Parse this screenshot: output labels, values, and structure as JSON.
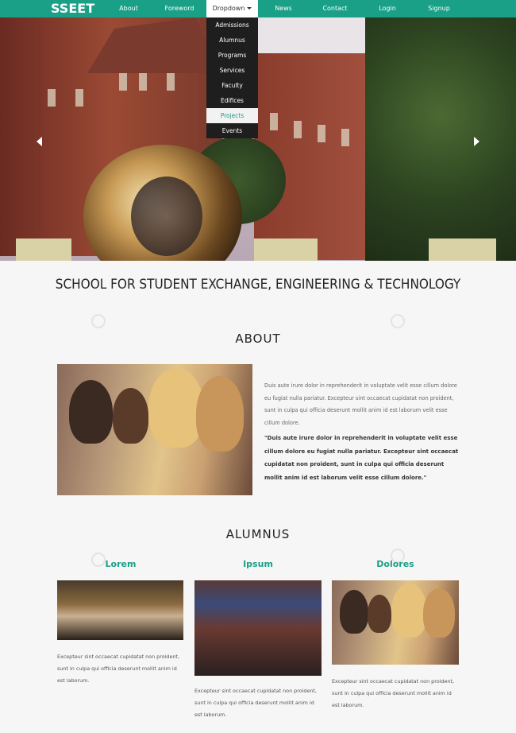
{
  "brand": "SSEET",
  "nav": {
    "items": [
      "About",
      "Foreword",
      "Dropdown",
      "News",
      "Contact",
      "Login",
      "Signup"
    ]
  },
  "dropdown": {
    "items": [
      "Admissions",
      "Alumnus",
      "Programs",
      "Services",
      "Faculty",
      "Edifices",
      "Projects",
      "Events"
    ]
  },
  "main_title": "SCHOOL FOR STUDENT EXCHANGE, ENGINEERING & TECHNOLOGY",
  "about": {
    "heading": "ABOUT",
    "paragraph": "Duis aute irure dolor in reprehenderit in voluptate velit esse cillum dolore eu fugiat nulla pariatur. Excepteur sint occaecat cupidatat non proident, sunt in culpa qui officia deserunt mollit anim id est laborum velit esse cillum dolore.",
    "quote": "\"Duis aute irure dolor in reprehenderit in voluptate velit esse cillum dolore eu fugiat nulla pariatur. Excepteur sint occaecat cupidatat non proident, sunt in culpa qui officia deserunt mollit anim id est laborum velit esse cillum dolore.\""
  },
  "alumnus": {
    "heading": "ALUMNUS",
    "columns": [
      {
        "title": "Lorem",
        "text": "Excepteur sint occaecat cupidatat non proident, sunt in culpa qui officia deserunt mollit anim id est laborum."
      },
      {
        "title": "Ipsum",
        "text": "Excepteur sint occaecat cupidatat non proident, sunt in culpa qui officia deserunt mollit anim id est laborum."
      },
      {
        "title": "Dolores",
        "text": "Excepteur sint occaecat cupidatat non proident, sunt in culpa qui officia deserunt mollit anim id est laborum."
      }
    ]
  },
  "colors": {
    "accent": "#19a086",
    "dropdown_bg": "#1e1e1e",
    "page_bg": "#f6f6f6"
  }
}
